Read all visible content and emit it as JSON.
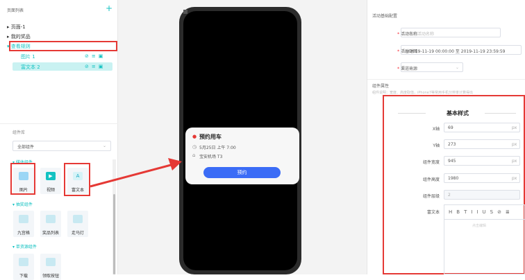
{
  "left_panel": {
    "page_list_title": "页面列表",
    "add_symbol": "+",
    "tree": [
      {
        "label": "页面-1",
        "arrow": "▸"
      },
      {
        "label": "我的奖品",
        "arrow": "▸"
      },
      {
        "label": "查看规则",
        "arrow": "▾"
      }
    ],
    "children": [
      {
        "label": "图片 1"
      },
      {
        "label": "富文本 2"
      }
    ],
    "component_lib_title": "组件库",
    "filter_value": "全部组件",
    "groups": [
      {
        "label": "媒体组件",
        "items": [
          {
            "label": "图片",
            "icon": "image-icon"
          },
          {
            "label": "视频",
            "icon": "video-icon"
          },
          {
            "label": "富文本",
            "icon": "rich-text-icon"
          }
        ]
      },
      {
        "label": "抽奖组件",
        "items": [
          {
            "label": "九宫格",
            "icon": "grid-icon"
          },
          {
            "label": "奖品列表",
            "icon": "list-icon"
          },
          {
            "label": "走马灯",
            "icon": "marquee-icon"
          }
        ]
      },
      {
        "label": "单资源组件",
        "items": [
          {
            "label": "下载",
            "icon": "download-icon"
          },
          {
            "label": "领取按钮",
            "icon": "button-icon"
          }
        ]
      }
    ],
    "colors": {
      "accent": "#13c2c2",
      "highlight_border": "#e53935"
    }
  },
  "phone": {
    "card_title": "预约用车",
    "card_time": "5月25日 上午 7:00",
    "card_place": "宝安机场 T3",
    "card_button": "预约",
    "colors": {
      "button": "#3b6cf6"
    }
  },
  "right_panel": {
    "section_title": "活动基础配置",
    "fields": [
      {
        "label": "活动名称",
        "required": true,
        "placeholder": "请输入活动名称"
      },
      {
        "label": "活动时间",
        "required": true,
        "start": "2019-11-19 00:00:00",
        "separator": "至",
        "end": "2019-11-19 23:59:59"
      },
      {
        "label": "渠道来源",
        "required": true,
        "placeholder": "请选择"
      }
    ],
    "component_props_title": "组件属性",
    "props_hint": "组件说明：宽度、高度取值，iPhone7等常用手机分辨率计算得出",
    "basic_style_title": "基本样式",
    "style_fields": [
      {
        "label": "X轴",
        "value": "69",
        "unit": "px"
      },
      {
        "label": "Y轴",
        "value": "273",
        "unit": "px"
      },
      {
        "label": "组件宽度",
        "value": "945",
        "unit": "px"
      },
      {
        "label": "组件高度",
        "value": "1980",
        "unit": "px"
      },
      {
        "label": "组件层级",
        "value": "2",
        "unit": ""
      }
    ],
    "rich_text_label": "富文本",
    "toolbar": [
      "H",
      "B",
      "TI",
      "I",
      "U",
      "S",
      "⊘",
      "≣"
    ],
    "editor_placeholder": "点击编辑"
  }
}
